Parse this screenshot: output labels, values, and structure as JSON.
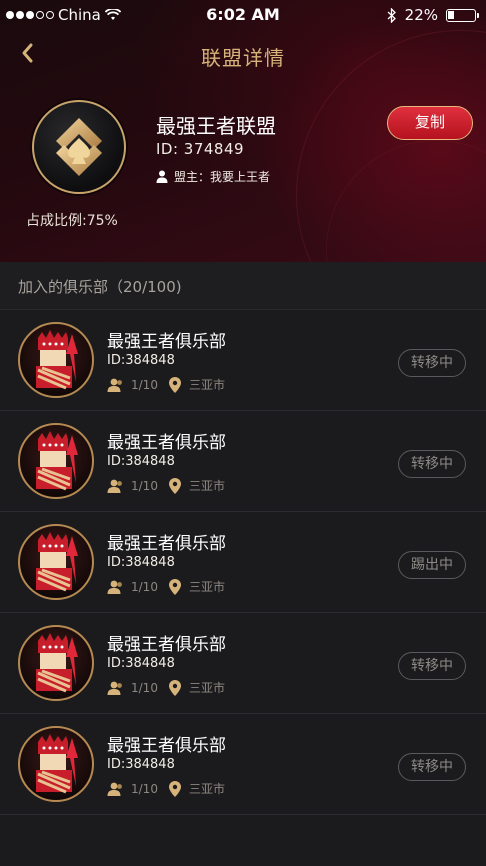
{
  "status_bar": {
    "carrier": "China",
    "time": "6:02 AM",
    "battery": "22%",
    "battery_level": 0.22
  },
  "nav": {
    "title": "联盟详情",
    "back_icon": "chevron-left-icon"
  },
  "union": {
    "name": "最强王者联盟",
    "id_text": "ID:  374849",
    "owner_text": "盟主：我要上王者",
    "ratio_text": "占成比例:75%",
    "copy_label": "复制"
  },
  "section": {
    "title": "加入的俱乐部（20/100)"
  },
  "clubs": [
    {
      "name": "最强王者俱乐部",
      "id": "ID:384848",
      "members": "1/10",
      "city": "三亚市",
      "status": "转移中"
    },
    {
      "name": "最强王者俱乐部",
      "id": "ID:384848",
      "members": "1/10",
      "city": "三亚市",
      "status": "转移中"
    },
    {
      "name": "最强王者俱乐部",
      "id": "ID:384848",
      "members": "1/10",
      "city": "三亚市",
      "status": "踢出中"
    },
    {
      "name": "最强王者俱乐部",
      "id": "ID:384848",
      "members": "1/10",
      "city": "三亚市",
      "status": "转移中"
    },
    {
      "name": "最强王者俱乐部",
      "id": "ID:384848",
      "members": "1/10",
      "city": "三亚市",
      "status": "转移中"
    }
  ],
  "colors": {
    "gold": "#d6b37a",
    "accent_red": "#c81e2b",
    "background": "#1b1b1d"
  }
}
